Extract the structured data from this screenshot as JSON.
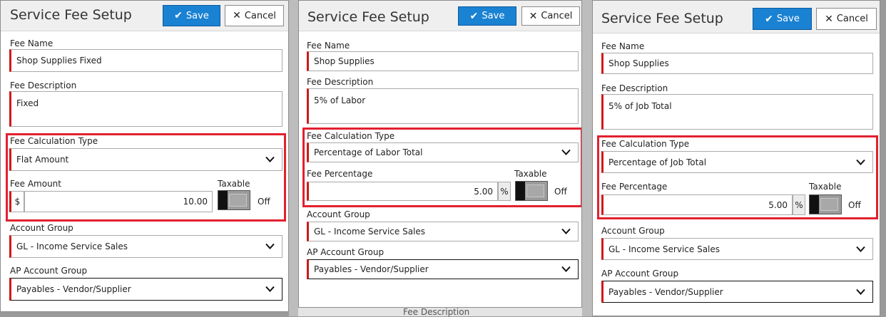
{
  "colors": {
    "accent": "#1a82d2",
    "required": "#d01919",
    "highlight": "#e2202e"
  },
  "background": {
    "partial_label": "Fee Description"
  },
  "panels": [
    {
      "title": "Service Fee Setup",
      "save_label": "Save",
      "cancel_label": "Cancel",
      "fee_name_label": "Fee Name",
      "fee_name_value": "Shop Supplies Fixed",
      "fee_description_label": "Fee Description",
      "fee_description_value": "Fixed",
      "calc_type_label": "Fee Calculation Type",
      "calc_type_value": "Flat Amount",
      "amount_label": "Fee Amount",
      "currency_symbol": "$",
      "amount_value": "10.00",
      "taxable_label": "Taxable",
      "taxable_state": "Off",
      "account_group_label": "Account Group",
      "account_group_value": "GL - Income Service Sales",
      "ap_account_group_label": "AP Account Group",
      "ap_account_group_value": "Payables - Vendor/Supplier"
    },
    {
      "title": "Service Fee Setup",
      "save_label": "Save",
      "cancel_label": "Cancel",
      "fee_name_label": "Fee Name",
      "fee_name_value": "Shop Supplies",
      "fee_description_label": "Fee Description",
      "fee_description_value": "5% of Labor",
      "calc_type_label": "Fee Calculation Type",
      "calc_type_value": "Percentage of Labor Total",
      "percentage_label": "Fee Percentage",
      "percentage_value": "5.00",
      "percent_symbol": "%",
      "taxable_label": "Taxable",
      "taxable_state": "Off",
      "account_group_label": "Account Group",
      "account_group_value": "GL - Income Service Sales",
      "ap_account_group_label": "AP Account Group",
      "ap_account_group_value": "Payables - Vendor/Supplier"
    },
    {
      "title": "Service Fee Setup",
      "save_label": "Save",
      "cancel_label": "Cancel",
      "fee_name_label": "Fee Name",
      "fee_name_value": "Shop Supplies",
      "fee_description_label": "Fee Description",
      "fee_description_value": "5% of Job Total",
      "calc_type_label": "Fee Calculation Type",
      "calc_type_value": "Percentage of Job Total",
      "percentage_label": "Fee Percentage",
      "percentage_value": "5.00",
      "percent_symbol": "%",
      "taxable_label": "Taxable",
      "taxable_state": "Off",
      "account_group_label": "Account Group",
      "account_group_value": "GL - Income Service Sales",
      "ap_account_group_label": "AP Account Group",
      "ap_account_group_value": "Payables - Vendor/Supplier"
    }
  ]
}
